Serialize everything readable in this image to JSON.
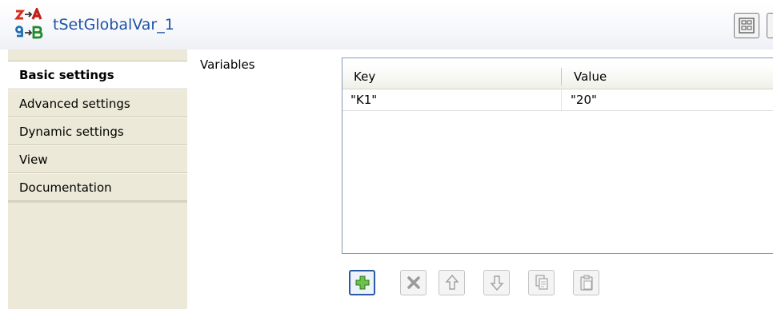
{
  "header": {
    "title": "tSetGlobalVar_1",
    "component_icon": "tsetglobalvar-icon",
    "buttons": [
      "layout-toggle-icon",
      "overflow-button"
    ]
  },
  "tabs": [
    {
      "label": "Basic settings",
      "active": true
    },
    {
      "label": "Advanced settings",
      "active": false
    },
    {
      "label": "Dynamic settings",
      "active": false
    },
    {
      "label": "View",
      "active": false
    },
    {
      "label": "Documentation",
      "active": false
    }
  ],
  "main": {
    "variables_label": "Variables",
    "table": {
      "columns": [
        "Key",
        "Value"
      ],
      "rows": [
        {
          "key": "\"K1\"",
          "value": "\"20\""
        }
      ]
    },
    "toolbar": [
      {
        "icon": "add-icon",
        "enabled": true
      },
      {
        "icon": "delete-icon",
        "enabled": false
      },
      {
        "icon": "move-up-icon",
        "enabled": false
      },
      {
        "icon": "move-down-icon",
        "enabled": false
      },
      {
        "icon": "copy-icon",
        "enabled": false
      },
      {
        "icon": "paste-icon",
        "enabled": false
      }
    ]
  },
  "colors": {
    "title": "#1f52a5",
    "panel": "#ece9d8",
    "add_button_border": "#2c5aa0"
  }
}
